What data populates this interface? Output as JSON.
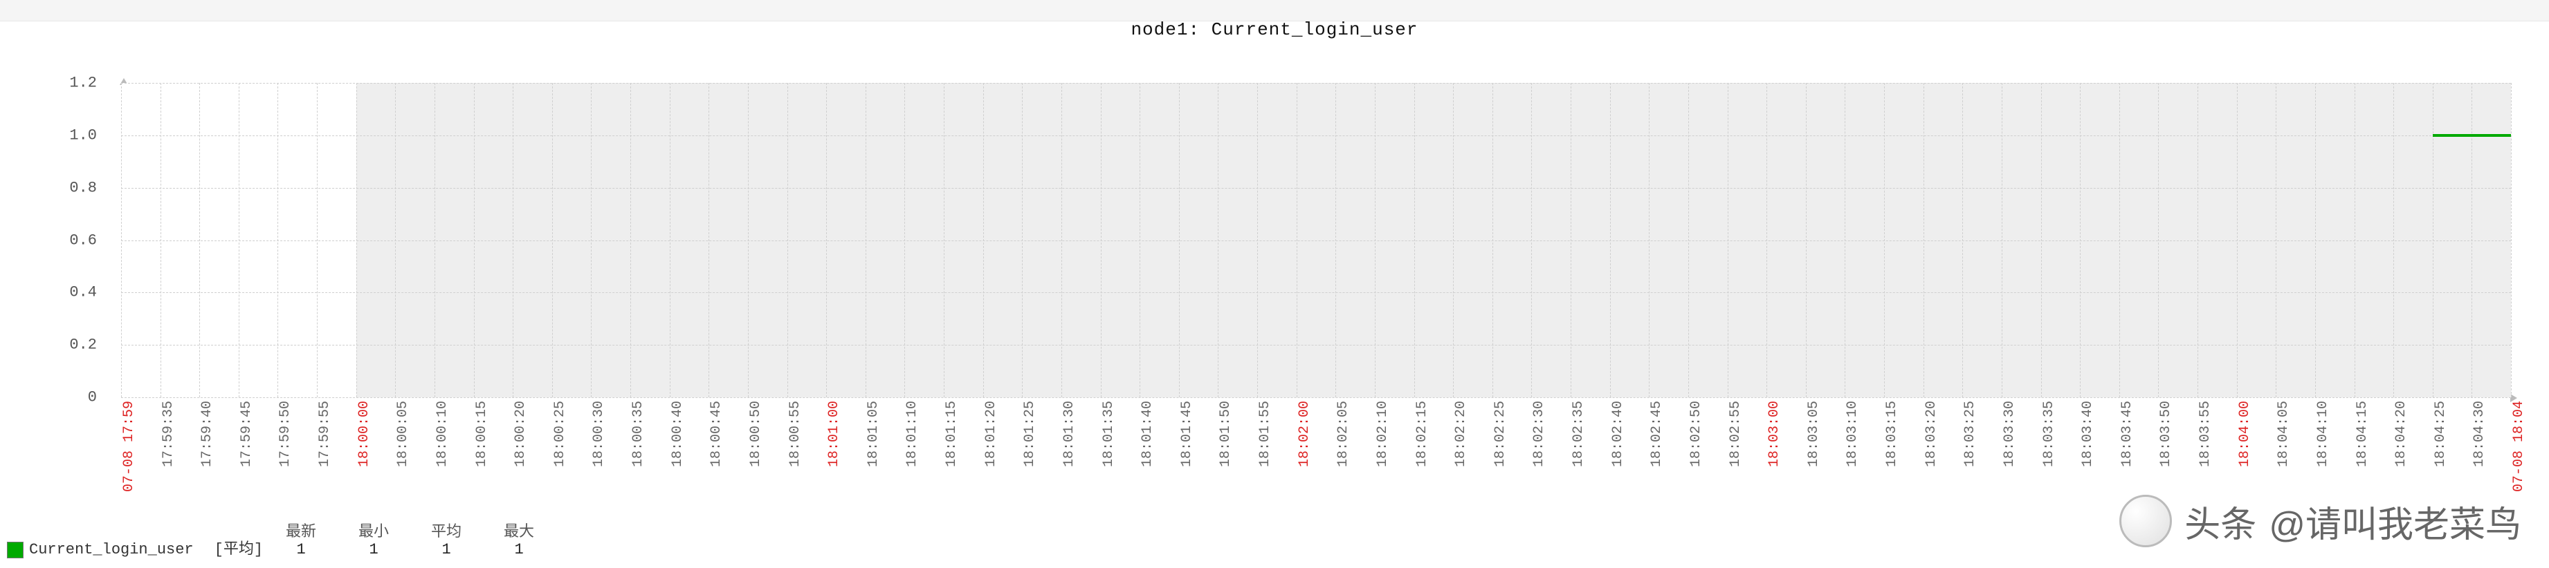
{
  "title": "node1:  Current_login_user",
  "chart_data": {
    "type": "line",
    "title": "node1: Current_login_user",
    "xlabel": "",
    "ylabel": "",
    "ylim": [
      0,
      1.2
    ],
    "y_ticks": [
      0,
      0.2,
      0.4,
      0.6,
      0.8,
      1.0,
      1.2
    ],
    "x_ticks": [
      {
        "label": "07-08 17:59",
        "major": true
      },
      {
        "label": "17:59:35",
        "major": false
      },
      {
        "label": "17:59:40",
        "major": false
      },
      {
        "label": "17:59:45",
        "major": false
      },
      {
        "label": "17:59:50",
        "major": false
      },
      {
        "label": "17:59:55",
        "major": false
      },
      {
        "label": "18:00:00",
        "major": true
      },
      {
        "label": "18:00:05",
        "major": false
      },
      {
        "label": "18:00:10",
        "major": false
      },
      {
        "label": "18:00:15",
        "major": false
      },
      {
        "label": "18:00:20",
        "major": false
      },
      {
        "label": "18:00:25",
        "major": false
      },
      {
        "label": "18:00:30",
        "major": false
      },
      {
        "label": "18:00:35",
        "major": false
      },
      {
        "label": "18:00:40",
        "major": false
      },
      {
        "label": "18:00:45",
        "major": false
      },
      {
        "label": "18:00:50",
        "major": false
      },
      {
        "label": "18:00:55",
        "major": false
      },
      {
        "label": "18:01:00",
        "major": true
      },
      {
        "label": "18:01:05",
        "major": false
      },
      {
        "label": "18:01:10",
        "major": false
      },
      {
        "label": "18:01:15",
        "major": false
      },
      {
        "label": "18:01:20",
        "major": false
      },
      {
        "label": "18:01:25",
        "major": false
      },
      {
        "label": "18:01:30",
        "major": false
      },
      {
        "label": "18:01:35",
        "major": false
      },
      {
        "label": "18:01:40",
        "major": false
      },
      {
        "label": "18:01:45",
        "major": false
      },
      {
        "label": "18:01:50",
        "major": false
      },
      {
        "label": "18:01:55",
        "major": false
      },
      {
        "label": "18:02:00",
        "major": true
      },
      {
        "label": "18:02:05",
        "major": false
      },
      {
        "label": "18:02:10",
        "major": false
      },
      {
        "label": "18:02:15",
        "major": false
      },
      {
        "label": "18:02:20",
        "major": false
      },
      {
        "label": "18:02:25",
        "major": false
      },
      {
        "label": "18:02:30",
        "major": false
      },
      {
        "label": "18:02:35",
        "major": false
      },
      {
        "label": "18:02:40",
        "major": false
      },
      {
        "label": "18:02:45",
        "major": false
      },
      {
        "label": "18:02:50",
        "major": false
      },
      {
        "label": "18:02:55",
        "major": false
      },
      {
        "label": "18:03:00",
        "major": true
      },
      {
        "label": "18:03:05",
        "major": false
      },
      {
        "label": "18:03:10",
        "major": false
      },
      {
        "label": "18:03:15",
        "major": false
      },
      {
        "label": "18:03:20",
        "major": false
      },
      {
        "label": "18:03:25",
        "major": false
      },
      {
        "label": "18:03:30",
        "major": false
      },
      {
        "label": "18:03:35",
        "major": false
      },
      {
        "label": "18:03:40",
        "major": false
      },
      {
        "label": "18:03:45",
        "major": false
      },
      {
        "label": "18:03:50",
        "major": false
      },
      {
        "label": "18:03:55",
        "major": false
      },
      {
        "label": "18:04:00",
        "major": true
      },
      {
        "label": "18:04:05",
        "major": false
      },
      {
        "label": "18:04:10",
        "major": false
      },
      {
        "label": "18:04:15",
        "major": false
      },
      {
        "label": "18:04:20",
        "major": false
      },
      {
        "label": "18:04:25",
        "major": false
      },
      {
        "label": "18:04:30",
        "major": false
      },
      {
        "label": "07-08 18:04",
        "major": true
      }
    ],
    "shade_from_index": 6,
    "series": [
      {
        "name": "Current_login_user",
        "color": "#00aa00",
        "segments": [
          {
            "x_start_index": 59,
            "x_end_index": 61,
            "value": 1.0
          }
        ]
      }
    ]
  },
  "legend": {
    "series_name": "Current_login_user",
    "agg_label": "[平均]",
    "stats": {
      "latest_label": "最新",
      "latest_value": "1",
      "min_label": "最小",
      "min_value": "1",
      "avg_label": "平均",
      "avg_value": "1",
      "max_label": "最大",
      "max_value": "1"
    }
  },
  "watermark": {
    "prefix": "头条",
    "name": "@请叫我老菜鸟"
  }
}
